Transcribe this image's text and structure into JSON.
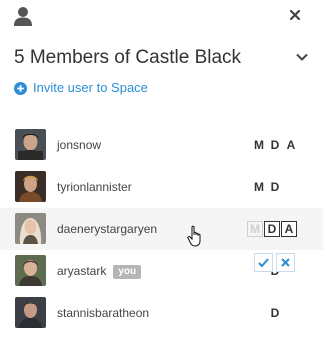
{
  "header": {
    "title": "5 Members of Castle Black"
  },
  "invite": {
    "label": "Invite user to Space"
  },
  "members": [
    {
      "username": "jonsnow",
      "permissions": [
        "M",
        "D",
        "A"
      ]
    },
    {
      "username": "tyrionlannister",
      "permissions": [
        "M",
        "D"
      ]
    },
    {
      "username": "daenerystargaryen",
      "permissions": [
        "M",
        "D",
        "A"
      ],
      "editing": true,
      "enabled": [
        false,
        true,
        true
      ]
    },
    {
      "username": "aryastark",
      "badge": "you",
      "permissions": [
        "D"
      ]
    },
    {
      "username": "stannisbaratheon",
      "permissions": [
        "D"
      ]
    }
  ],
  "edit_actions": {
    "confirm_icon": "check-icon",
    "cancel_icon": "close-icon"
  },
  "colors": {
    "accent": "#2b8fd6",
    "badge": "#b5b5b5",
    "highlight_row": "#f5f5f5"
  }
}
